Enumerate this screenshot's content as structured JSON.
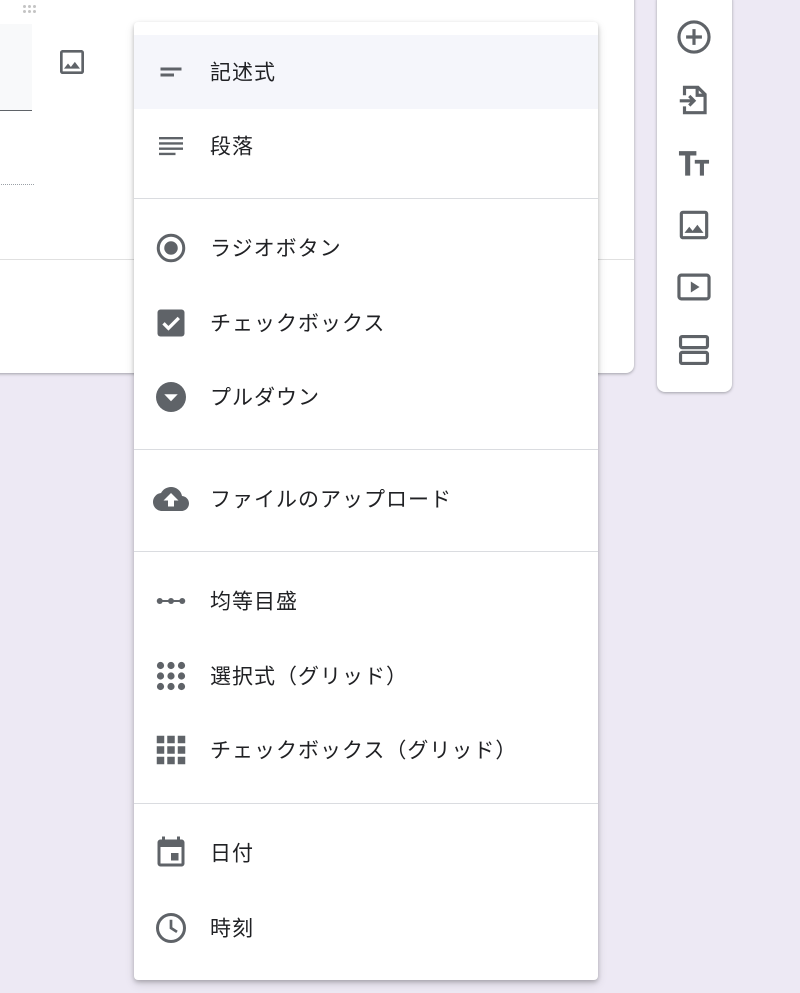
{
  "menu": {
    "items": [
      {
        "icon": "short-answer-icon",
        "label": "記述式"
      },
      {
        "icon": "paragraph-icon",
        "label": "段落"
      },
      {
        "icon": "radio-button-icon",
        "label": "ラジオボタン"
      },
      {
        "icon": "checkbox-icon",
        "label": "チェックボックス"
      },
      {
        "icon": "dropdown-icon",
        "label": "プルダウン"
      },
      {
        "icon": "cloud-upload-icon",
        "label": "ファイルのアップロード"
      },
      {
        "icon": "linear-scale-icon",
        "label": "均等目盛"
      },
      {
        "icon": "multiple-choice-grid-icon",
        "label": "選択式（グリッド）"
      },
      {
        "icon": "checkbox-grid-icon",
        "label": "チェックボックス（グリッド）"
      },
      {
        "icon": "calendar-icon",
        "label": "日付"
      },
      {
        "icon": "clock-icon",
        "label": "時刻"
      }
    ],
    "selected_index": 0
  },
  "toolbar": {
    "buttons": [
      "add-question-icon",
      "import-questions-icon",
      "add-title-icon",
      "add-image-icon",
      "add-video-icon",
      "add-section-icon"
    ]
  },
  "colors": {
    "background": "#ede9f4",
    "icon": "#5f6368",
    "text": "#202124",
    "selected_row": "#f5f6fb"
  }
}
